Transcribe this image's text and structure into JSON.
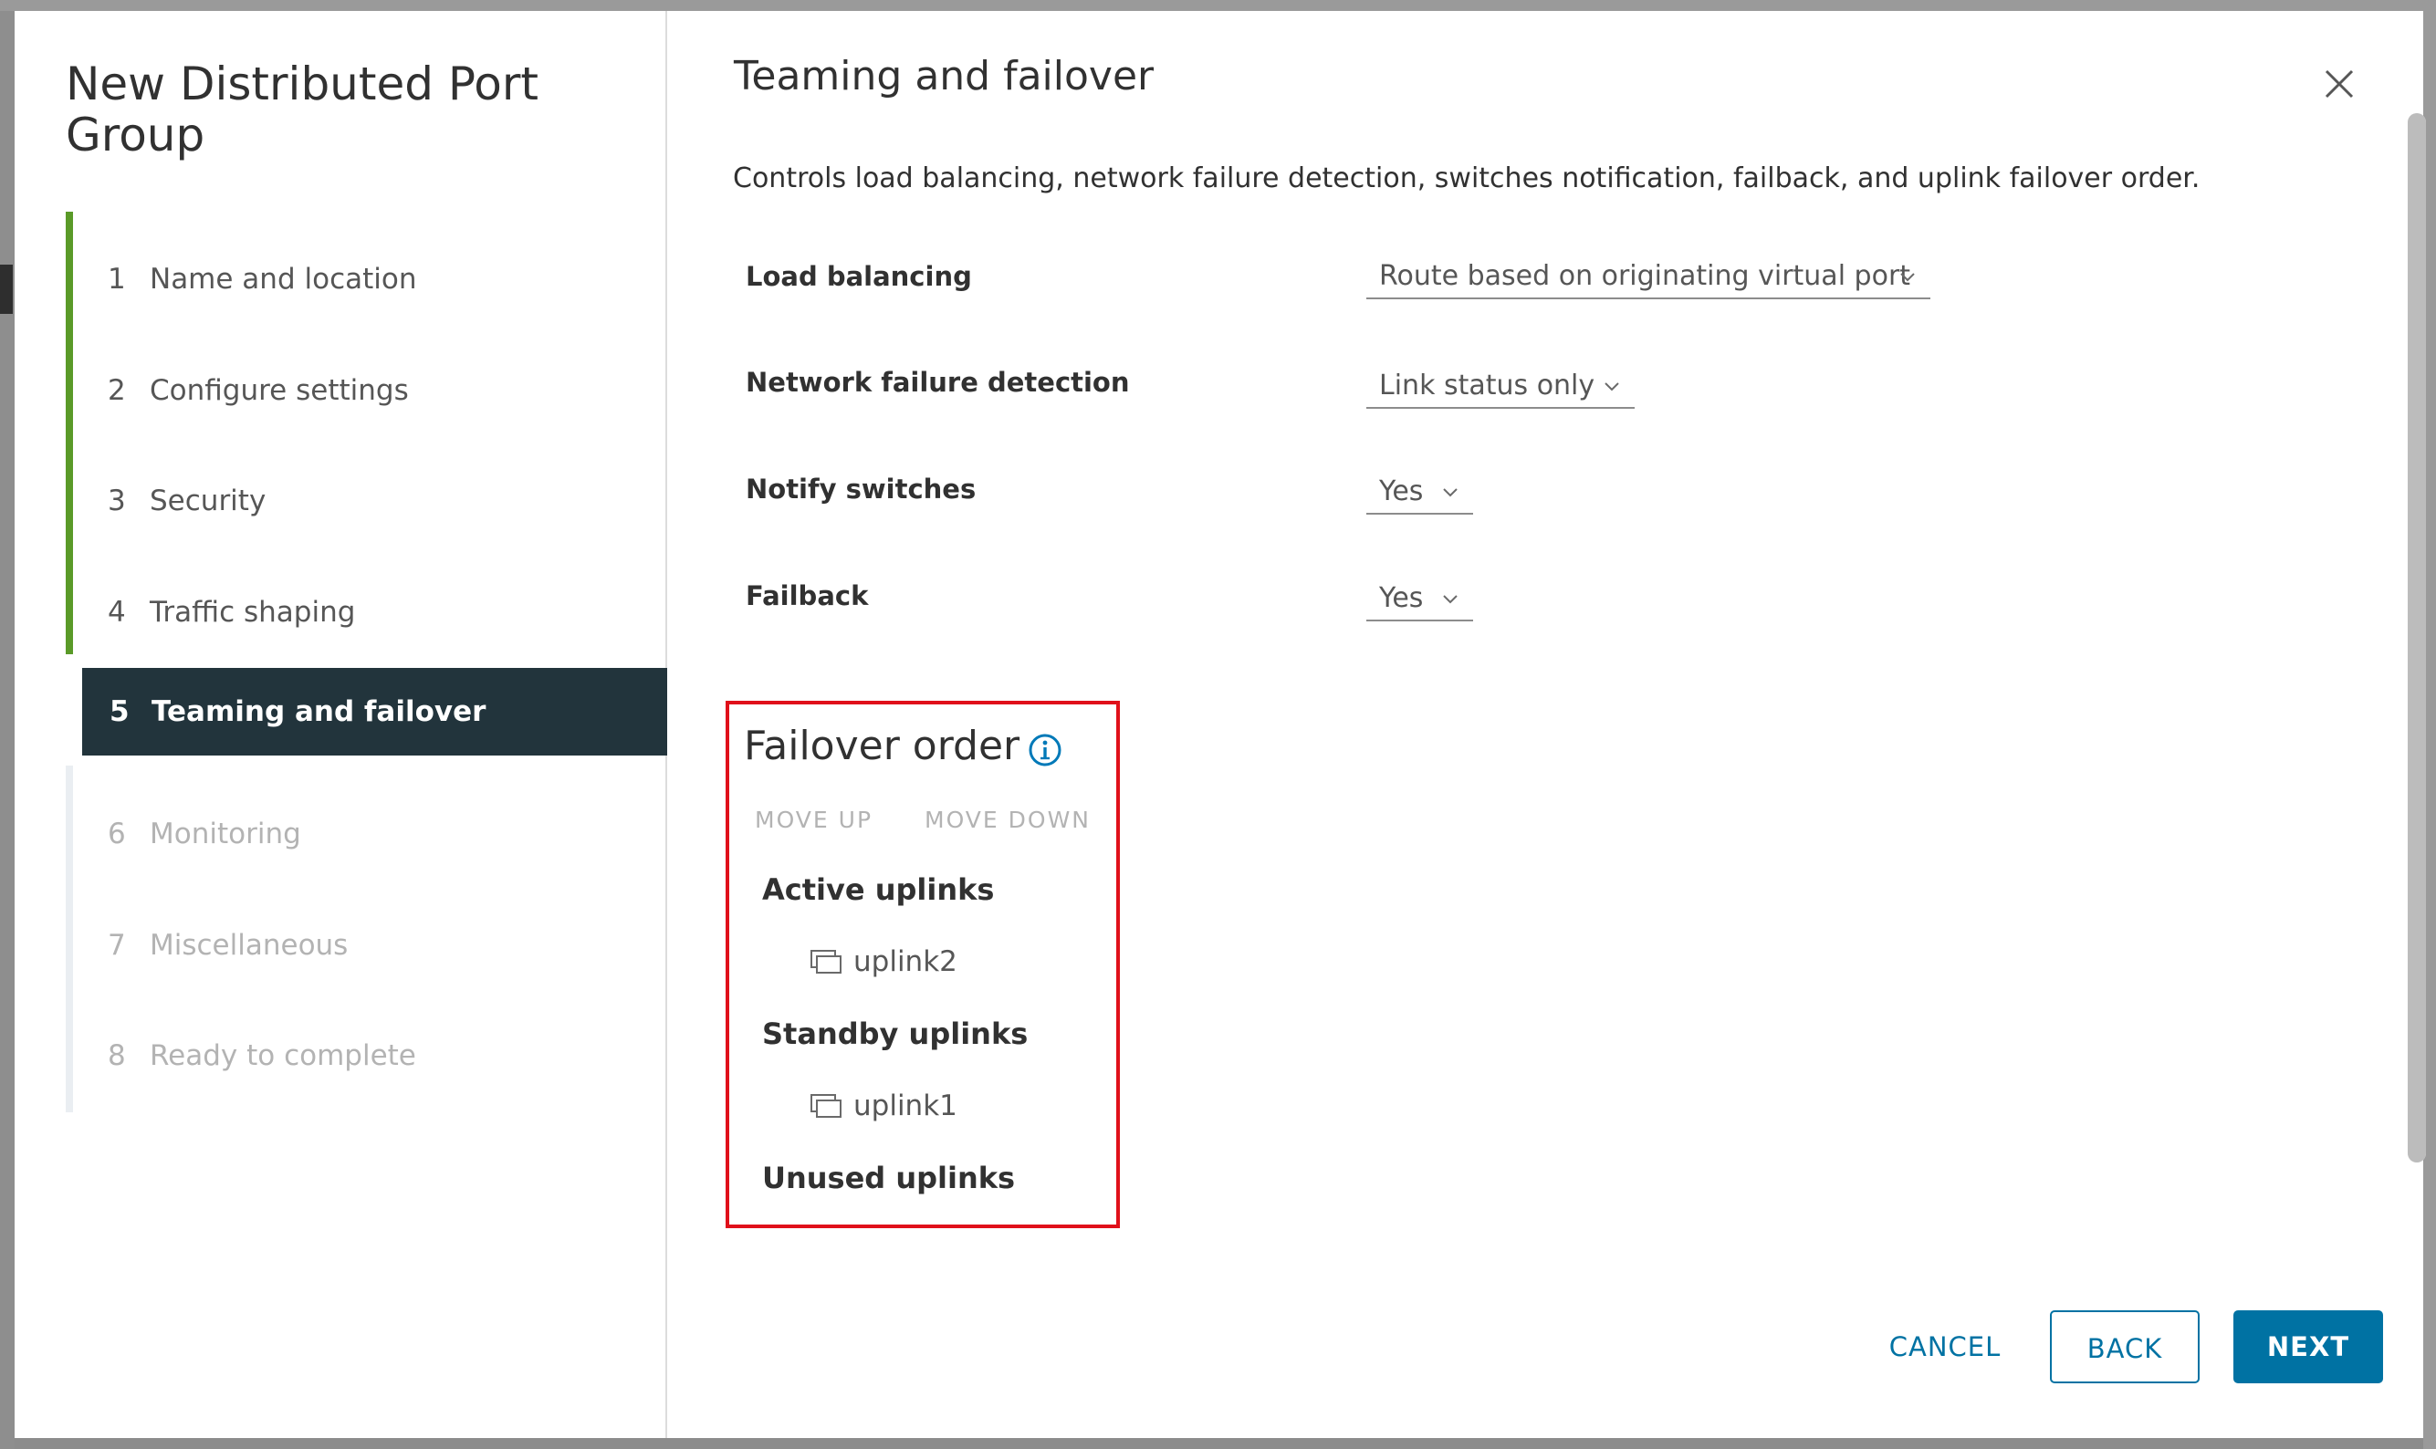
{
  "wizard": {
    "title": "New Distributed Port Group",
    "steps": [
      {
        "num": "1",
        "label": "Name and location",
        "state": "done"
      },
      {
        "num": "2",
        "label": "Configure settings",
        "state": "done"
      },
      {
        "num": "3",
        "label": "Security",
        "state": "done"
      },
      {
        "num": "4",
        "label": "Traffic shaping",
        "state": "done"
      },
      {
        "num": "5",
        "label": "Teaming and failover",
        "state": "active"
      },
      {
        "num": "6",
        "label": "Monitoring",
        "state": "disabled"
      },
      {
        "num": "7",
        "label": "Miscellaneous",
        "state": "disabled"
      },
      {
        "num": "8",
        "label": "Ready to complete",
        "state": "disabled"
      }
    ]
  },
  "page": {
    "title": "Teaming and failover",
    "description": "Controls load balancing, network failure detection, switches notification, failback, and uplink failover order."
  },
  "settings": {
    "load_balancing": {
      "label": "Load balancing",
      "value": "Route based on originating virtual port"
    },
    "network_failure_detection": {
      "label": "Network failure detection",
      "value": "Link status only"
    },
    "notify_switches": {
      "label": "Notify switches",
      "value": "Yes"
    },
    "failback": {
      "label": "Failback",
      "value": "Yes"
    }
  },
  "failover": {
    "title": "Failover order",
    "move_up": "MOVE UP",
    "move_down": "MOVE DOWN",
    "active_label": "Active uplinks",
    "active_uplinks": [
      "uplink2"
    ],
    "standby_label": "Standby uplinks",
    "standby_uplinks": [
      "uplink1"
    ],
    "unused_label": "Unused uplinks"
  },
  "footer": {
    "cancel": "CANCEL",
    "back": "BACK",
    "next": "NEXT"
  },
  "colors": {
    "accent": "#0072a3",
    "progress": "#5a9a28",
    "active_step_bg": "#22343c",
    "highlight": "#e0101a"
  },
  "icons": {
    "close": "close-icon",
    "info": "info-icon",
    "chevron": "chevron-down-icon",
    "uplink": "uplink-port-icon"
  }
}
